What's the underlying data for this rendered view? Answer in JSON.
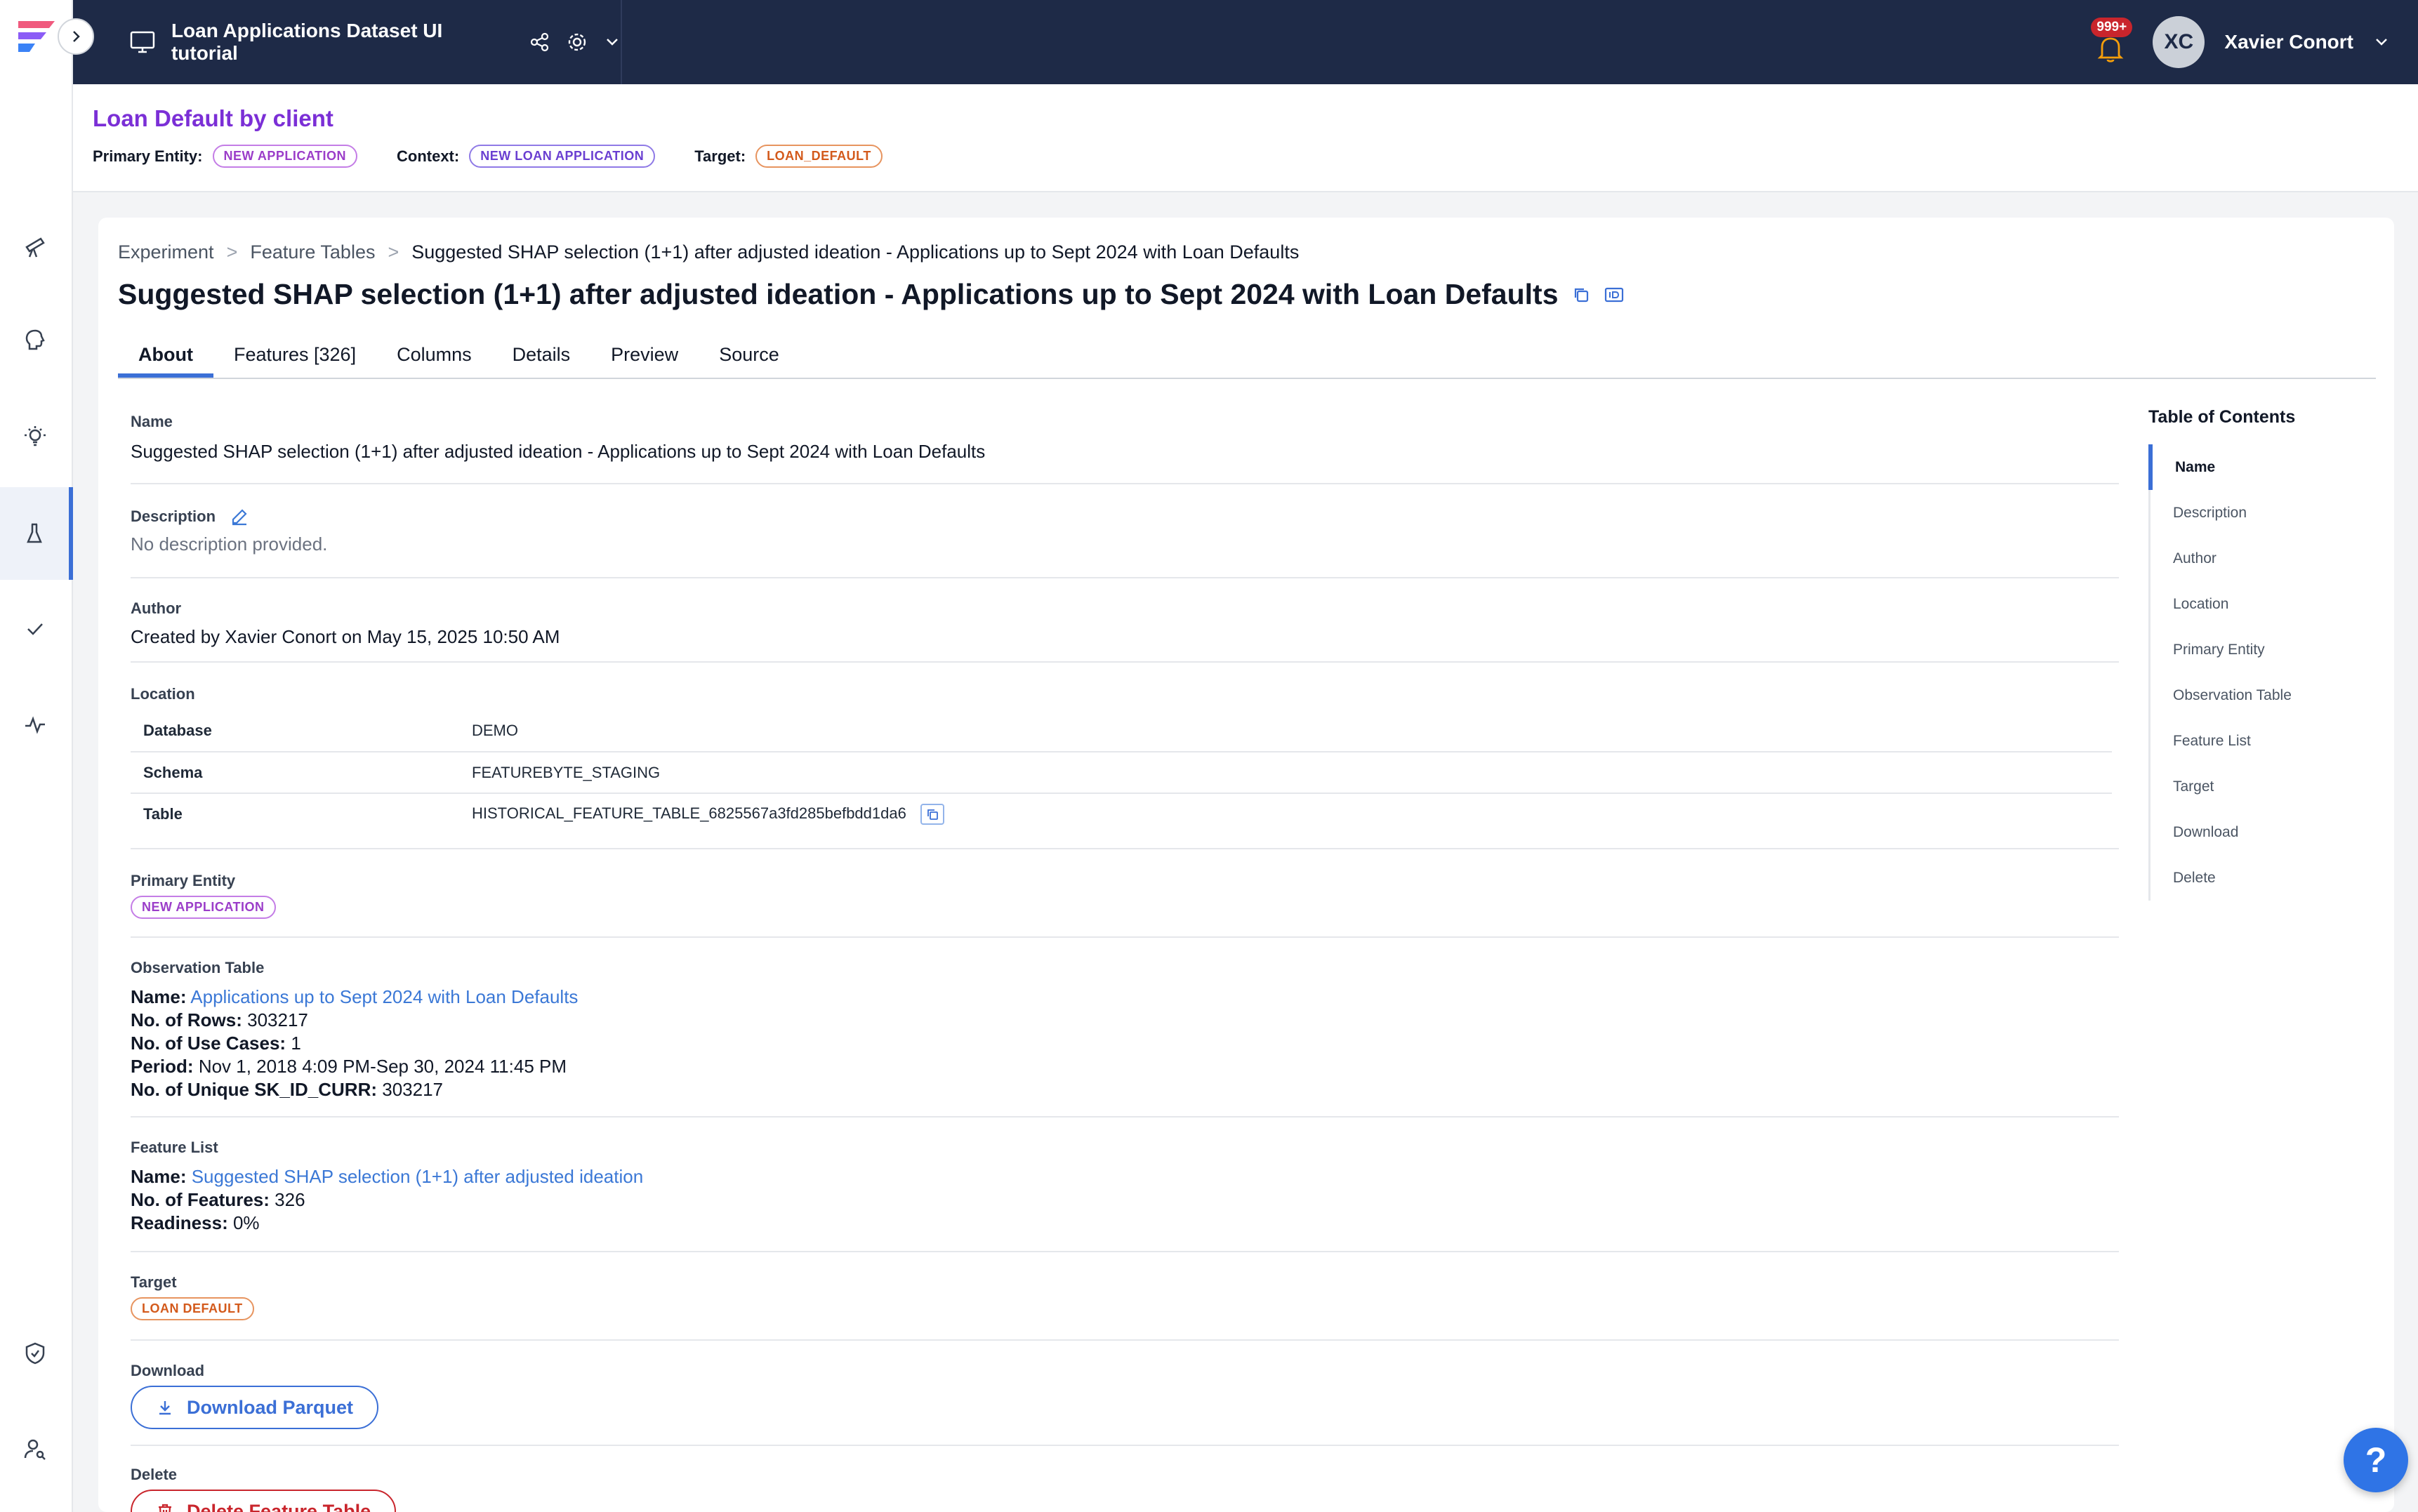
{
  "topbar": {
    "project_name": "Loan Applications Dataset UI tutorial",
    "notifications": "999+",
    "avatar_initials": "XC",
    "user_name": "Xavier Conort"
  },
  "context": {
    "title": "Loan Default by client",
    "primary_entity_label": "Primary Entity:",
    "primary_entity": "NEW APPLICATION",
    "context_label": "Context:",
    "context": "NEW LOAN APPLICATION",
    "target_label": "Target:",
    "target": "LOAN_DEFAULT"
  },
  "breadcrumb": {
    "items": [
      "Experiment",
      "Feature Tables"
    ],
    "separator": ">",
    "current": "Suggested SHAP selection (1+1) after adjusted ideation - Applications up to Sept 2024 with Loan Defaults"
  },
  "page_title": "Suggested SHAP selection (1+1) after adjusted ideation - Applications up to Sept 2024 with Loan Defaults",
  "tabs": [
    "About",
    "Features [326]",
    "Columns",
    "Details",
    "Preview",
    "Source"
  ],
  "about": {
    "name_label": "Name",
    "name_value": "Suggested SHAP selection (1+1) after adjusted ideation - Applications up to Sept 2024 with Loan Defaults",
    "description_label": "Description",
    "description_value": "No description provided.",
    "author_label": "Author",
    "author_value": "Created by Xavier Conort on May 15, 2025 10:50 AM",
    "location_label": "Location",
    "location_rows": [
      {
        "key": "Database",
        "value": "DEMO"
      },
      {
        "key": "Schema",
        "value": "FEATUREBYTE_STAGING"
      },
      {
        "key": "Table",
        "value": "HISTORICAL_FEATURE_TABLE_6825567a3fd285befbdd1da6"
      }
    ],
    "primary_entity_label": "Primary Entity",
    "primary_entity": "NEW APPLICATION",
    "observation_label": "Observation Table",
    "obs_name_key": "Name:",
    "obs_name": "Applications up to Sept 2024 with Loan Defaults",
    "obs_rows_key": "No. of Rows:",
    "obs_rows": "303217",
    "obs_usecases_key": "No. of Use Cases:",
    "obs_usecases": "1",
    "obs_period_key": "Period:",
    "obs_period": "Nov 1, 2018 4:09 PM-Sep 30, 2024 11:45 PM",
    "obs_unique_key": "No. of Unique SK_ID_CURR:",
    "obs_unique": "303217",
    "feature_list_label": "Feature List",
    "fl_name_key": "Name:",
    "fl_name": "Suggested SHAP selection (1+1) after adjusted ideation",
    "fl_features_key": "No. of Features:",
    "fl_features": "326",
    "fl_readiness_key": "Readiness:",
    "fl_readiness": "0%",
    "target_label": "Target",
    "target": "LOAN DEFAULT",
    "download_label": "Download",
    "download_button": "Download Parquet",
    "delete_label": "Delete",
    "delete_button": "Delete Feature Table"
  },
  "toc": {
    "title": "Table of Contents",
    "items": [
      "Name",
      "Description",
      "Author",
      "Location",
      "Primary Entity",
      "Observation Table",
      "Feature List",
      "Target",
      "Download",
      "Delete"
    ]
  },
  "help_label": "?",
  "colors": {
    "topbar": "#1e2a47",
    "accent": "#3b6fd6",
    "title_purple": "#7b2fd6",
    "danger": "#c9252c",
    "link": "#3b78d6"
  },
  "icons": [
    "monitor-icon",
    "share-icon",
    "gear-icon",
    "chevron-down-icon",
    "bell-icon",
    "telescope-icon",
    "brain-icon",
    "lightbulb-icon",
    "flask-icon",
    "check-icon",
    "pulse-icon",
    "shield-icon",
    "user-search-icon",
    "copy-icon",
    "id-icon",
    "edit-icon",
    "download-icon",
    "trash-icon"
  ]
}
